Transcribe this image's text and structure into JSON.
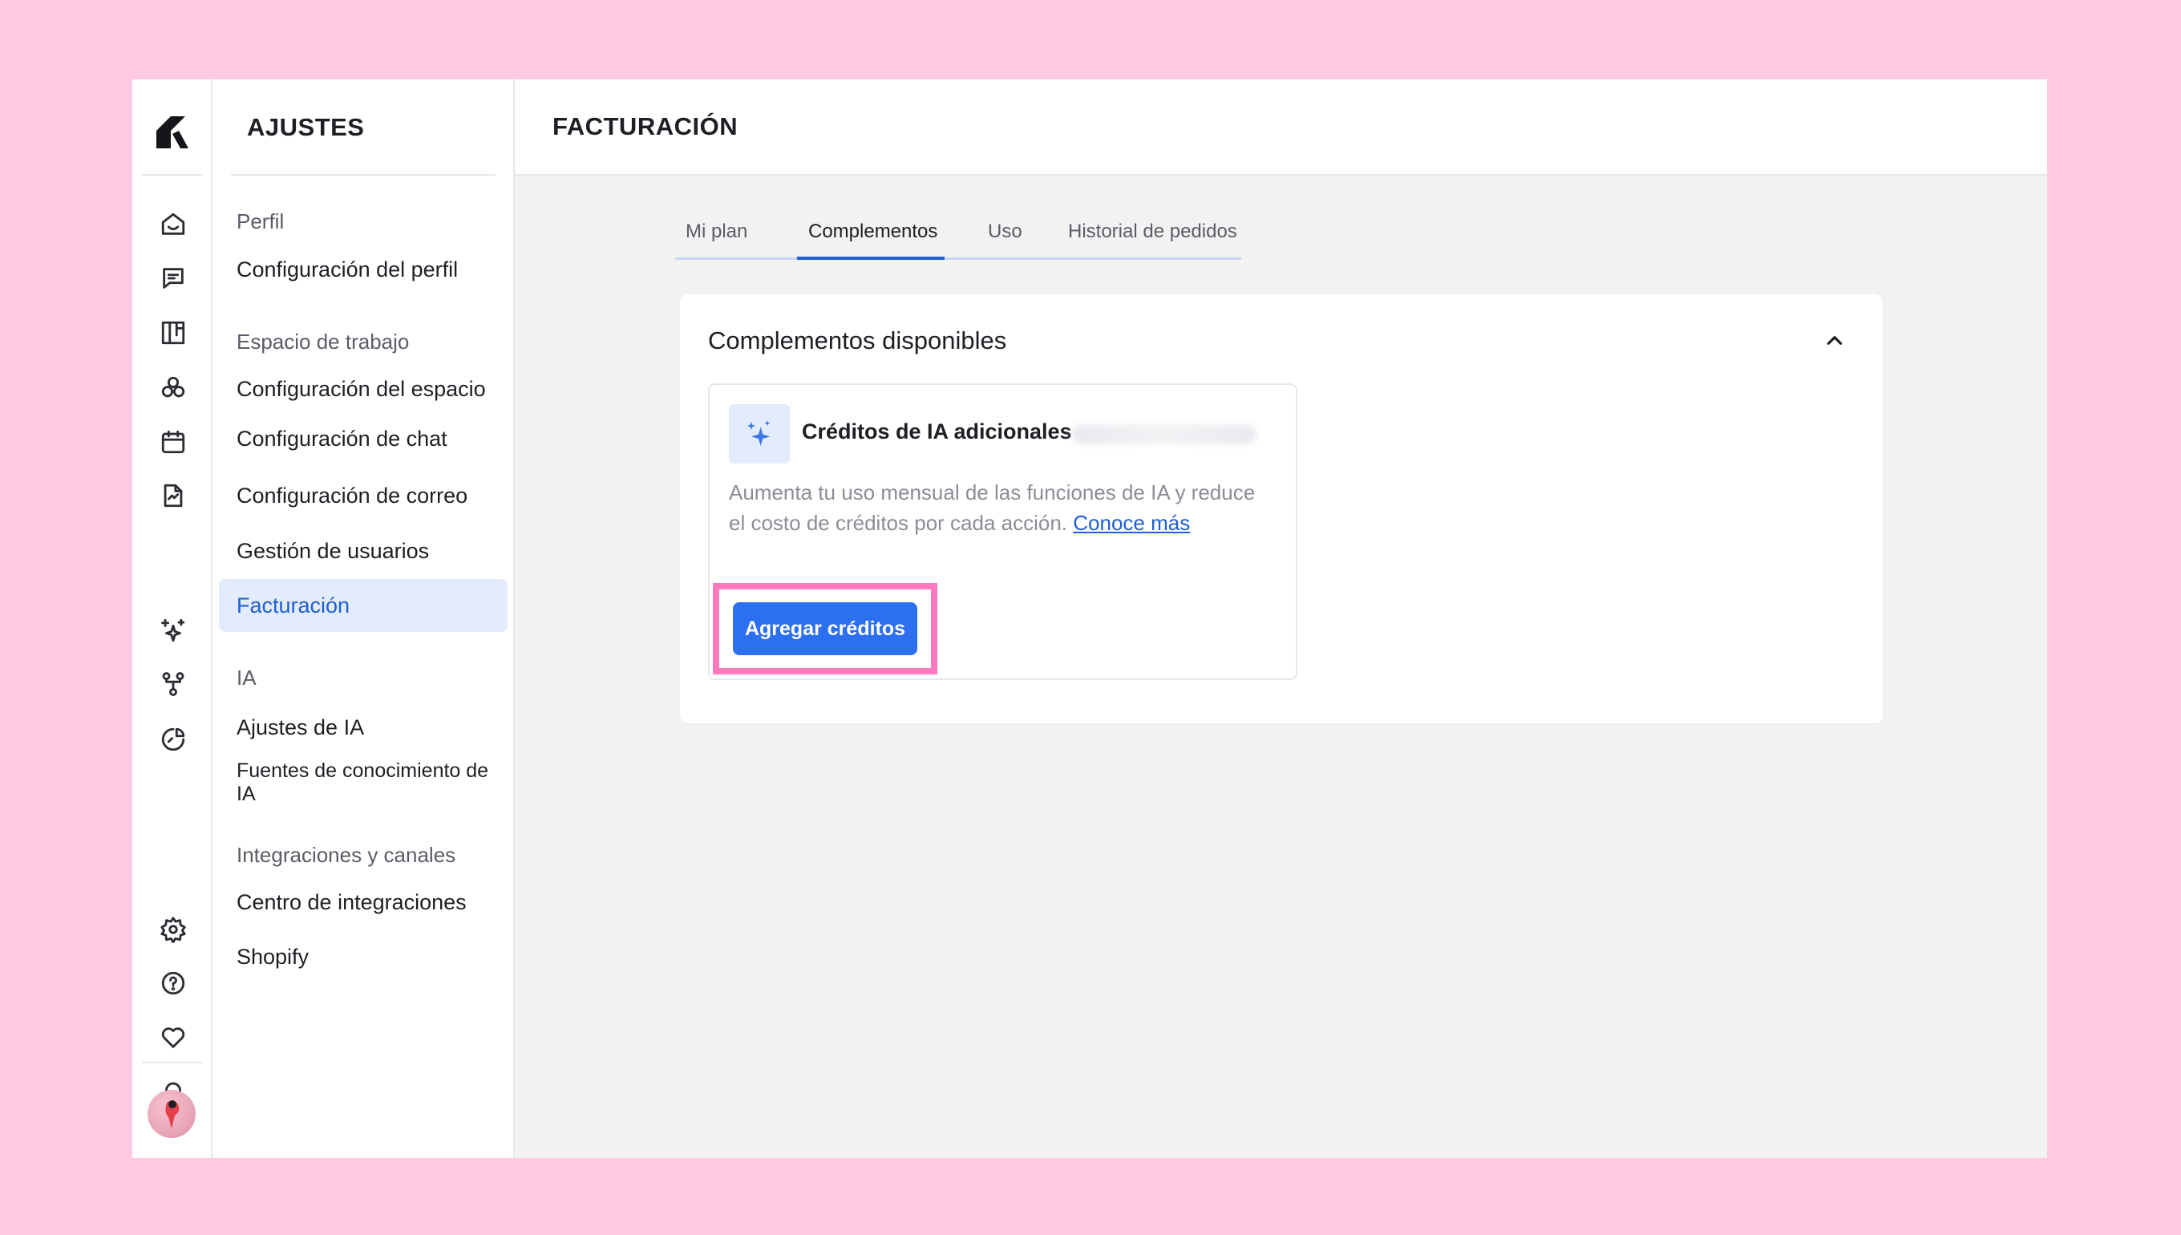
{
  "app": {
    "accent_color": "#1f5fd1",
    "button_color": "#2c6ff0",
    "highlight_color": "#ff79bc"
  },
  "rail": {
    "icons": [
      "home-icon",
      "chat-icon",
      "board-icon",
      "contacts-icon",
      "calendar-icon",
      "document-icon",
      "sparkles-icon",
      "workflow-icon",
      "analytics-icon",
      "settings-icon",
      "help-icon",
      "heart-icon",
      "bell-icon"
    ]
  },
  "settings": {
    "title": "AJUSTES",
    "sections": {
      "perfil": "Perfil",
      "espacio": "Espacio de trabajo",
      "ia": "IA",
      "integraciones": "Integraciones y canales"
    },
    "items": {
      "config_perfil": "Configuración del perfil",
      "config_espacio": "Configuración del espacio",
      "config_chat": "Configuración de chat",
      "config_correo": "Configuración de correo",
      "gestion_usuarios": "Gestión de usuarios",
      "facturacion": "Facturación",
      "ajustes_ia": "Ajustes de IA",
      "fuentes_ia": "Fuentes de conocimiento de IA",
      "centro_integraciones": "Centro de integraciones",
      "shopify": "Shopify"
    }
  },
  "main": {
    "title": "FACTURACIÓN",
    "tabs": {
      "mi_plan": "Mi plan",
      "complementos": "Complementos",
      "uso": "Uso",
      "historial": "Historial de pedidos"
    },
    "card": {
      "title": "Complementos disponibles",
      "addon": {
        "title": "Créditos de IA adicionales",
        "description": "Aumenta tu uso mensual de las funciones de IA y reduce el costo de créditos por cada acción.",
        "link": "Conoce más",
        "button": "Agregar créditos"
      }
    }
  }
}
